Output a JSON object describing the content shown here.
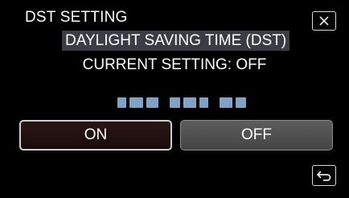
{
  "header": {
    "title": "DST SETTING"
  },
  "dialog": {
    "highlight_text": "DAYLIGHT SAVING TIME (DST)",
    "current_setting": "CURRENT SETTING: OFF"
  },
  "options": {
    "on_label": "ON",
    "off_label": "OFF"
  },
  "icons": {
    "close": "close-icon",
    "back": "back-icon"
  },
  "colors": {
    "background": "#000000",
    "highlight": "#3a3d44",
    "date_blocks": "#7fa3c6",
    "off_button": "#555555"
  }
}
